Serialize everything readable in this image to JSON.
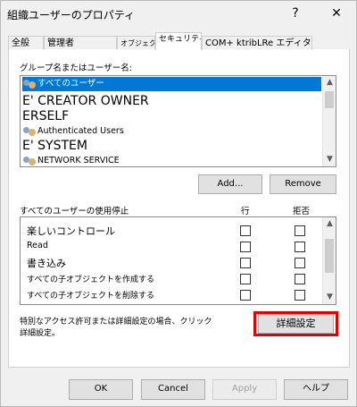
{
  "window": {
    "title": "組織ユーザーのプロパティ",
    "help_glyph": "?",
    "close_glyph": "✕"
  },
  "tabs": [
    "全般",
    "管理者",
    "オブジェクト",
    "セキュリティ",
    "COM+ ktribLRe エディター"
  ],
  "active_tab": "セキュリティ",
  "security": {
    "group_label": "グループ名またはユーザー名:",
    "principals": [
      {
        "name": "すべてのユーザー",
        "icon": "users-icon",
        "selected": true
      },
      {
        "name": "E' CREATOR OWNER",
        "icon": "",
        "selected": false
      },
      {
        "name": "ERSELF",
        "icon": "",
        "selected": false
      },
      {
        "name": "Authenticated Users",
        "icon": "users-icon",
        "selected": false
      },
      {
        "name": "E' SYSTEM",
        "icon": "",
        "selected": false
      },
      {
        "name": "NETWORK SERVICE",
        "icon": "users-icon",
        "selected": false
      }
    ],
    "add_button": "Add...",
    "remove_button": "Remove",
    "permissions_label": "すべてのユーザーの使用停止",
    "allow_header": "行",
    "deny_header": "拒否",
    "permissions": [
      {
        "name": "楽しいコントロール",
        "allow": false,
        "deny": false
      },
      {
        "name": "Read",
        "allow": false,
        "deny": false
      },
      {
        "name": "書き込み",
        "allow": false,
        "deny": false
      },
      {
        "name": "すべての子オブジェクトを作成する",
        "allow": false,
        "deny": false
      },
      {
        "name": "すべての子オブジェクトを削除する",
        "allow": false,
        "deny": false
      }
    ],
    "special_note_line1": "特別なアクセス許可または詳細設定の場合、クリック",
    "special_note_line2": "詳細設定。",
    "advanced_button": "詳細設定",
    "highlight_color": "#e00000"
  },
  "footer": {
    "ok": "OK",
    "cancel": "Cancel",
    "apply": "Apply",
    "help": "ヘルプ"
  },
  "colors": {
    "selection": "#0078d7",
    "accent_focus": "#0078d7"
  }
}
